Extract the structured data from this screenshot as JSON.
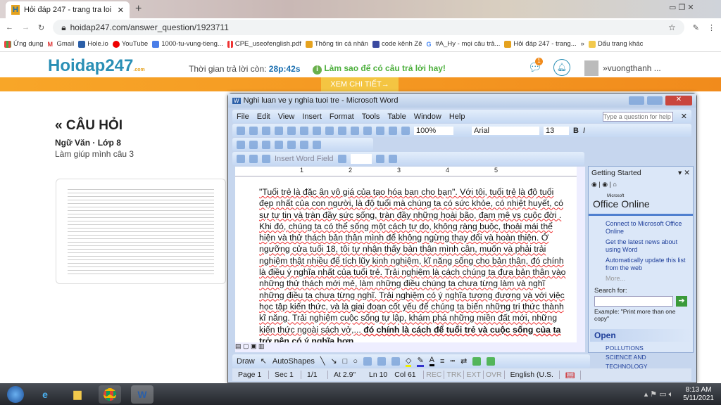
{
  "browser": {
    "tab_title": "Hỏi đáp 247 - trang tra loi",
    "url": "hoidap247.com/answer_question/1923711",
    "bookmarks": [
      "Ứng dụng",
      "Gmail",
      "Hole.io",
      "YouTube",
      "1000-tu-vung-tieng...",
      "CPE_useofenglish.pdf",
      "Thông tin cá nhân",
      "code kênh Zê",
      "#A_Hy - mọi câu trả...",
      "Hỏi đáp 247 - trang..."
    ],
    "more_bookmarks": "»",
    "other_bookmarks": "Dấu trang khác"
  },
  "site": {
    "logo": "Hoidap247",
    "logo_sub": ".com",
    "timer_label": "Thời gian trả lời còn:",
    "timer": "28p:42s",
    "tip": "Làm sao để có câu trả lời hay!",
    "notif_count": "1",
    "username": "vuongthanh ...",
    "banner": "XEM CHI TIẾT→",
    "heading": "« CÂU HỎI",
    "subject": "Ngữ Văn · Lớp 8",
    "question": "Làm giúp mình câu 3"
  },
  "word": {
    "title": "Nghi luan ve y nghia tuoi tre - Microsoft Word",
    "menu": [
      "File",
      "Edit",
      "View",
      "Insert",
      "Format",
      "Tools",
      "Table",
      "Window",
      "Help"
    ],
    "help_placeholder": "Type a question for help",
    "zoom": "100%",
    "font": "Arial",
    "size": "13",
    "insert_field": "Insert Word Field",
    "ruler": [
      "1",
      "2",
      "3",
      "4",
      "5"
    ],
    "body": "\"Tuổi trẻ là đặc ân vô giá của tạo hóa ban cho bạn\". Với tôi, tuổi trẻ là độ tuổi đẹp nhất của con người, là độ tuổi mà chúng ta có sức khỏe, có nhiệt huyết, có sự tự tin và tràn đầy sức sống, tràn đầy những hoài bão, đam mê vs cuộc đời . Khi đó, chúng ta có thể sống một cách tự do, không ràng buộc, thoải mái thể hiện và thử thách bản thân mình để không ngừng thay đổi và hoàn thiện. Ở ngưỡng cửa tuổi 18, tôi tự nhận thấy bản thân mình cần, muốn và phải trải nghiệm thật nhiều để tích lũy kinh nghiệm, kĩ năng sống cho bản thân, đó chính là điều ý nghĩa nhất của tuổi trẻ. Trải nghiệm là cách chúng ta đưa bản thân vào những thử thách mới mẻ, làm những điều chúng ta chưa từng làm và nghĩ những điều ta chưa từng nghĩ. Trải nghiệm có ý nghĩa tương đương và với việc học tập kiến thức, và là giai đoạn cốt yếu để chúng ta biến những tri thức thành kĩ năng. Trải nghiệm cuộc sống tự lập, khám phá những miền đất mới, những kiến thức ngoài sách vở,... ",
    "body_bold": "đó chính là cách để tuổi trẻ và cuộc sống của ta trở nên có ý nghĩa hơn.",
    "draw": "Draw",
    "autoshapes": "AutoShapes",
    "pane": {
      "title": "Getting Started",
      "brand_small": "Microsoft",
      "brand": "Office Online",
      "links": [
        "Connect to Microsoft Office Online",
        "Get the latest news about using Word",
        "Automatically update this list from the web"
      ],
      "more": "More...",
      "search_label": "Search for:",
      "example": "Example:  \"Print more than one copy\"",
      "open": "Open",
      "files": [
        "POLLUTIONS",
        "SCIENCE AND TECHNOLOGY"
      ]
    },
    "status": [
      "Page 1",
      "Sec 1",
      "1/1",
      "At 2.9\"",
      "Ln 10",
      "Col 61",
      "REC",
      "TRK",
      "EXT",
      "OVR",
      "English (U.S."
    ]
  },
  "taskbar": {
    "time": "8:13 AM",
    "date": "5/11/2021"
  }
}
